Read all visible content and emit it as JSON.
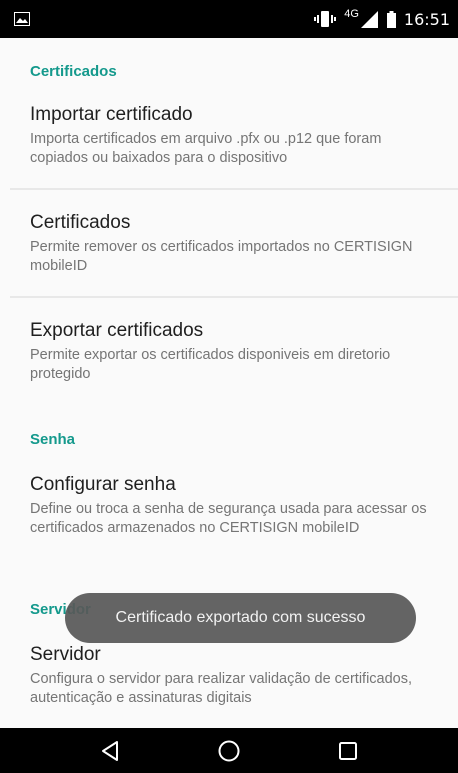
{
  "status_bar": {
    "time": "16:51",
    "network": "4G",
    "icons": [
      "image-notification-icon",
      "vibrate-icon",
      "signal-icon",
      "battery-icon"
    ]
  },
  "sections": [
    {
      "title": "Certificados",
      "items": [
        {
          "title": "Importar certificado",
          "summary": "Importa certificados em arquivo .pfx ou .p12 que foram copiados ou baixados para o dispositivo"
        },
        {
          "title": "Certificados",
          "summary": "Permite remover os certificados importados no CERTISIGN mobileID"
        },
        {
          "title": "Exportar certificados",
          "summary": "Permite exportar os certificados disponiveis em diretorio protegido"
        }
      ]
    },
    {
      "title": "Senha",
      "items": [
        {
          "title": "Configurar senha",
          "summary": "Define ou troca a senha de segurança usada para acessar os certificados armazenados no CERTISIGN mobileID"
        }
      ]
    },
    {
      "title": "Servidor",
      "items": [
        {
          "title": "Servidor",
          "summary": "Configura o servidor para realizar validação de certificados, autenticação e assinaturas digitais"
        }
      ]
    }
  ],
  "toast": {
    "message": "Certificado exportado com sucesso"
  },
  "nav_bar": {
    "buttons": [
      "back-icon",
      "home-icon",
      "recents-icon"
    ]
  },
  "colors": {
    "accent": "#14998c",
    "status_bar": "#000000",
    "toast": "#585858"
  }
}
